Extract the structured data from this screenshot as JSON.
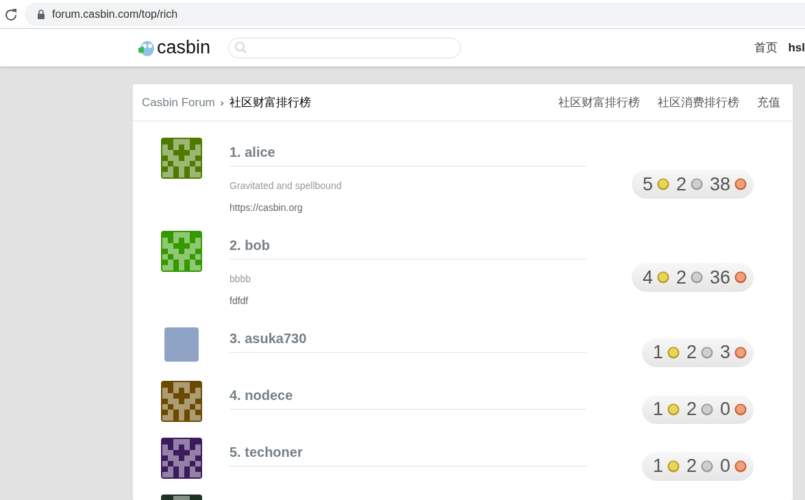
{
  "browser": {
    "address": "forum.casbin.com/top/rich"
  },
  "header": {
    "logo": "casbin",
    "nav": [
      {
        "label": "首页",
        "kind": "link"
      },
      {
        "label": "hsl",
        "kind": "user"
      }
    ]
  },
  "card": {
    "breadcrumb": {
      "root": "Casbin Forum",
      "separator": "›",
      "current": "社区财富排行榜"
    },
    "tabs": [
      {
        "label": "社区财富排行榜"
      },
      {
        "label": "社区消费排行榜"
      },
      {
        "label": "充值"
      }
    ],
    "users": [
      {
        "name": "1. alice",
        "bio": "Gravitated and spellbound",
        "website": "https://casbin.org",
        "avatar": {
          "kind": "identicon",
          "color": "#4e7a00"
        },
        "gold": "5",
        "silver": "2",
        "bronze": "38"
      },
      {
        "name": "2. bob",
        "bio": "bbbb",
        "website": "fdfdf",
        "avatar": {
          "kind": "identicon",
          "color": "#339900"
        },
        "gold": "4",
        "silver": "2",
        "bronze": "36"
      },
      {
        "name": "3. asuka730",
        "avatar": {
          "kind": "photo",
          "color": "#8fa3c7"
        },
        "gold": "1",
        "silver": "2",
        "bronze": "3"
      },
      {
        "name": "4. nodece",
        "avatar": {
          "kind": "identicon",
          "color": "#6b4a00"
        },
        "gold": "1",
        "silver": "2",
        "bronze": "0"
      },
      {
        "name": "5. techoner",
        "avatar": {
          "kind": "identicon",
          "color": "#3c1a5e"
        },
        "gold": "1",
        "silver": "2",
        "bronze": "0"
      },
      {
        "avatar": {
          "kind": "identicon",
          "color": "#1f3324"
        }
      }
    ]
  }
}
